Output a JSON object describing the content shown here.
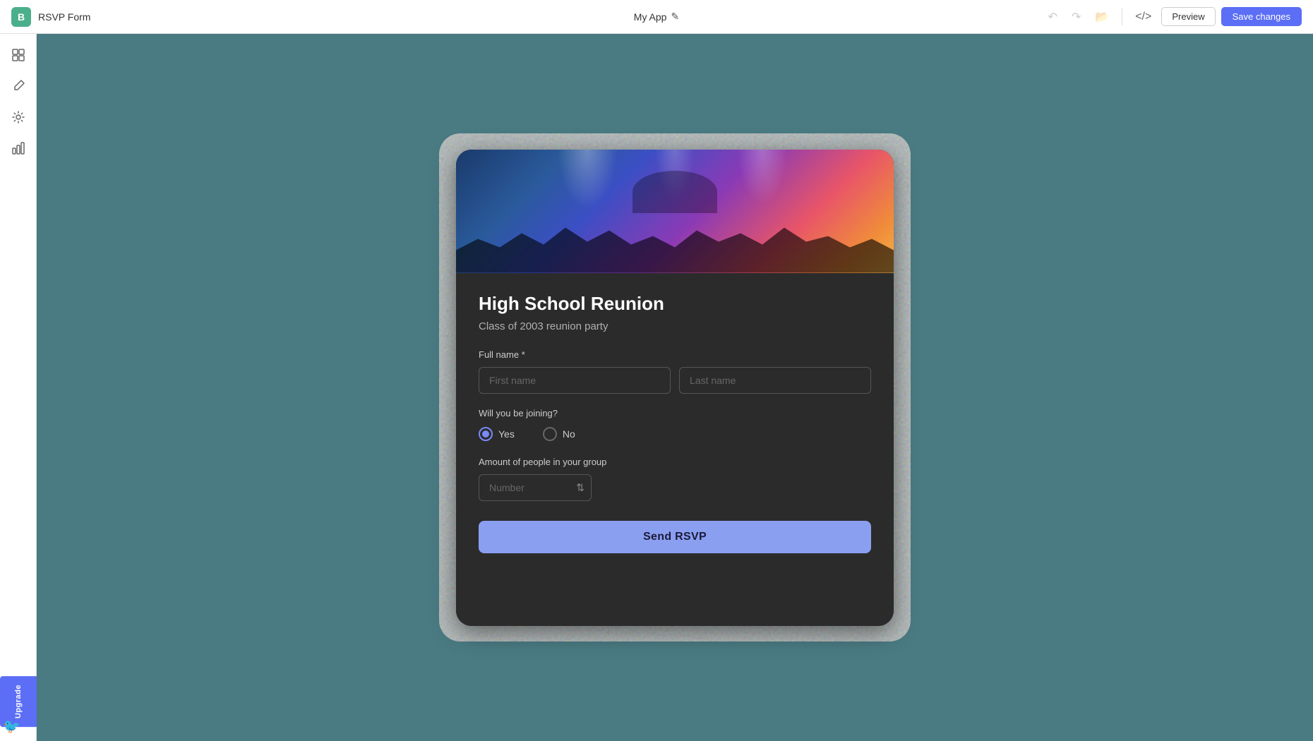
{
  "header": {
    "logo_letter": "B",
    "app_name": "RSVP Form",
    "center_title": "My App",
    "edit_icon": "✎",
    "preview_label": "Preview",
    "save_label": "Save changes"
  },
  "sidebar": {
    "items": [
      {
        "icon": "⊞",
        "label": "Layout",
        "name": "layout"
      },
      {
        "icon": "🔧",
        "label": "Tools",
        "name": "tools"
      },
      {
        "icon": "⚙",
        "label": "Settings",
        "name": "settings"
      },
      {
        "icon": "📊",
        "label": "Analytics",
        "name": "analytics"
      }
    ]
  },
  "form": {
    "title": "High School Reunion",
    "subtitle": "Class of 2003 reunion party",
    "full_name_label": "Full name *",
    "first_name_placeholder": "First name",
    "last_name_placeholder": "Last name",
    "joining_label": "Will you be joining?",
    "radio_yes": "Yes",
    "radio_no": "No",
    "amount_label": "Amount of people in your group",
    "number_placeholder": "Number",
    "send_label": "Send RSVP"
  },
  "upgrade": {
    "label": "Upgrade"
  }
}
